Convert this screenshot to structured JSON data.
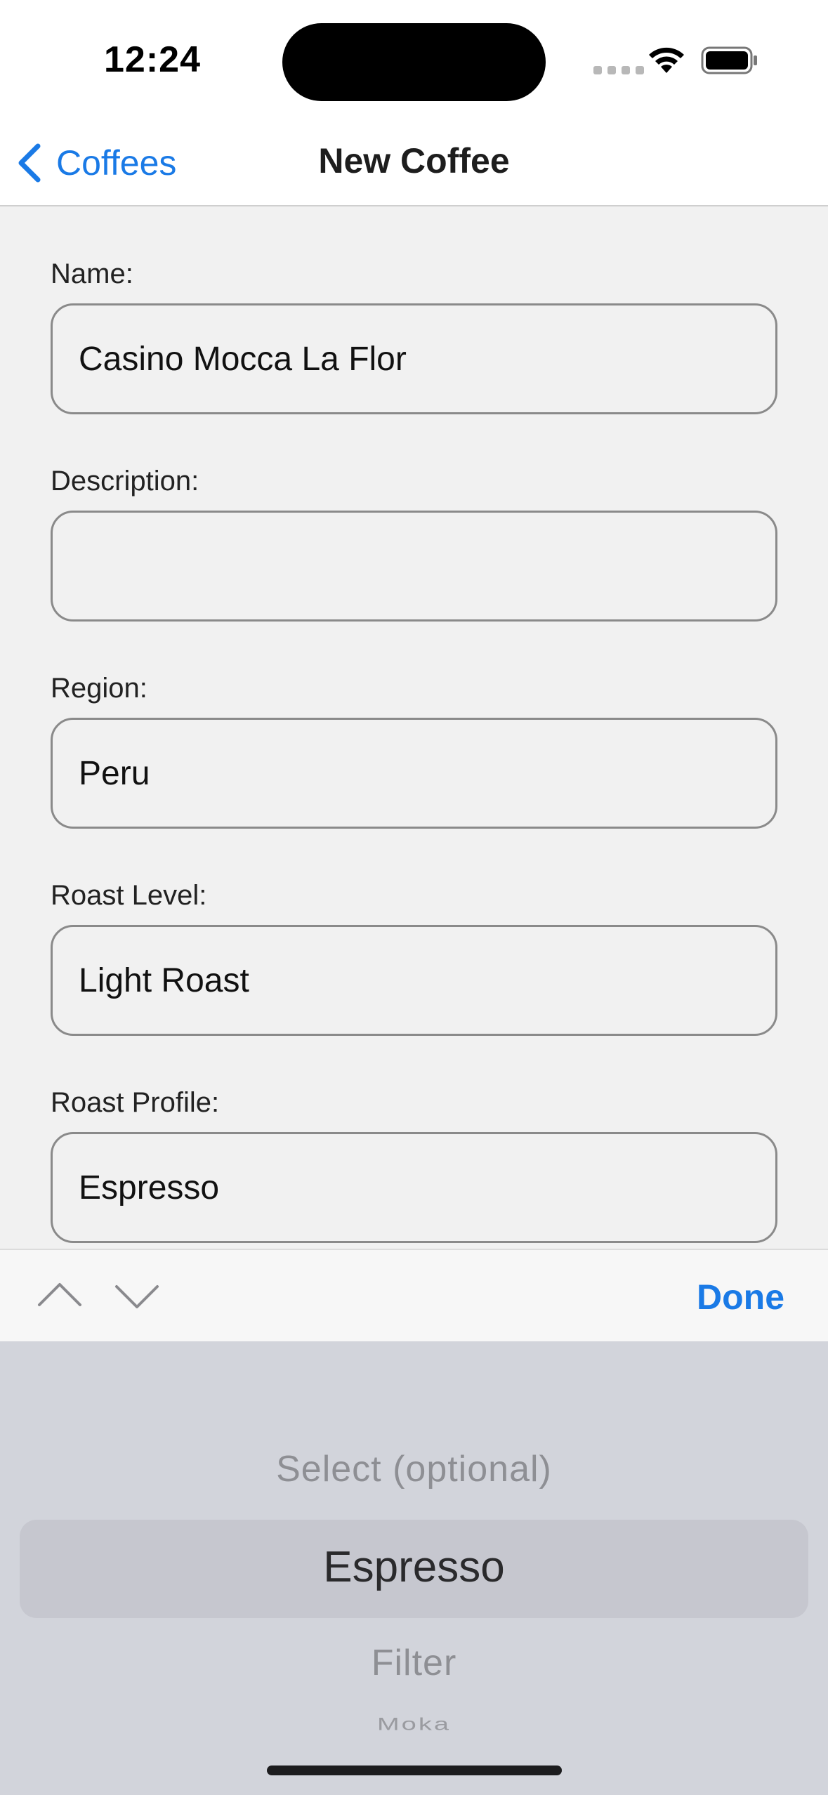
{
  "status_bar": {
    "time": "12:24"
  },
  "nav": {
    "back_label": "Coffees",
    "title": "New Coffee",
    "accent_color": "#1a7ae6"
  },
  "form": {
    "fields": [
      {
        "label": "Name:",
        "value": "Casino Mocca La Flor"
      },
      {
        "label": "Description:",
        "value": ""
      },
      {
        "label": "Region:",
        "value": "Peru"
      },
      {
        "label": "Roast Level:",
        "value": "Light Roast"
      },
      {
        "label": "Roast Profile:",
        "value": "Espresso"
      }
    ]
  },
  "toolbar": {
    "prev_icon": "chevron-up-icon",
    "next_icon": "chevron-down-icon",
    "done_label": "Done"
  },
  "picker": {
    "options": [
      "Select (optional)",
      "Espresso",
      "Filter",
      "Moka"
    ],
    "selected": "Espresso"
  }
}
